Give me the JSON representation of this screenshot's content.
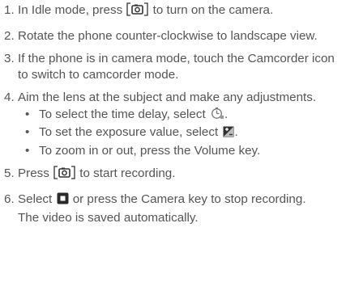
{
  "steps": [
    {
      "num": "1.",
      "before": "In Idle mode, press",
      "icon": "camera-key-icon",
      "after": "to turn on the camera."
    },
    {
      "num": "2.",
      "text": "Rotate the phone counter-clockwise to landscape view."
    },
    {
      "num": "3.",
      "text": "If the phone is in camera mode, touch the Camcorder icon to switch to camcorder mode."
    },
    {
      "num": "4.",
      "text": "Aim the lens at the subject and make any adjustments.",
      "bullets": [
        {
          "dot": "•",
          "text": "To select the time delay, select",
          "icon": "timer-icon",
          "end": "."
        },
        {
          "dot": "•",
          "text": "To set the exposure value, select",
          "icon": "exposure-icon",
          "end": "."
        },
        {
          "dot": "•",
          "text": "To zoom in or out, press the Volume key."
        }
      ]
    },
    {
      "num": "5.",
      "before": "Press",
      "icon": "camera-key-icon",
      "after": "to start recording."
    },
    {
      "num": "6.",
      "before": "Select",
      "icon": "stop-icon",
      "after": "or press the Camera key to stop recording.",
      "note": "The video is saved automatically."
    }
  ],
  "colors": {
    "text": "#555555",
    "icon_dark": "#333333"
  }
}
